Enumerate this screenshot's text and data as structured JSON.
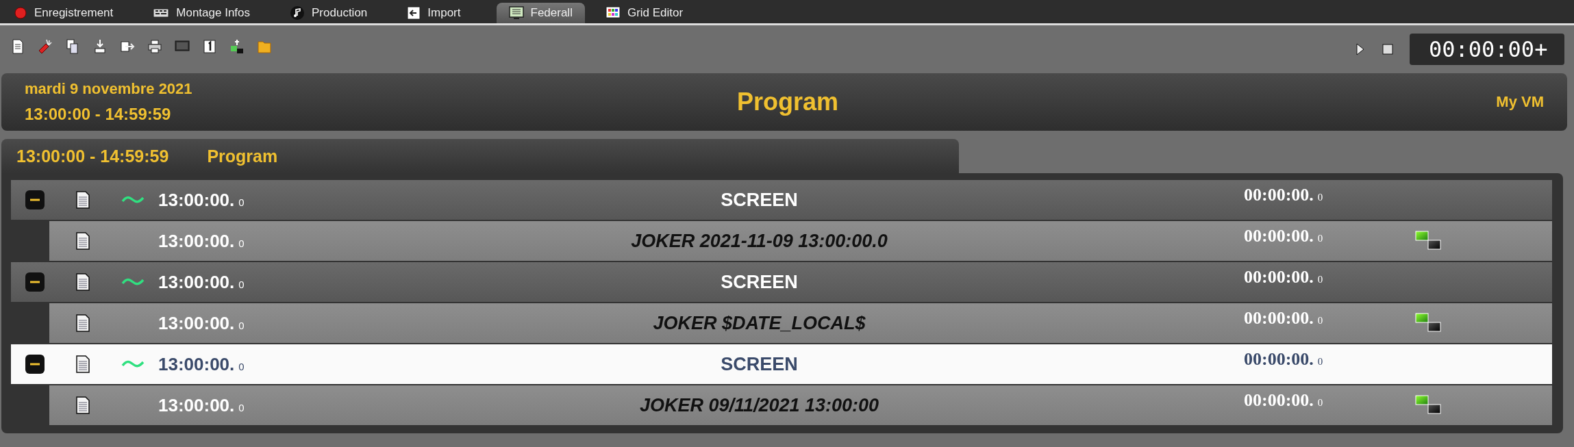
{
  "tabs": [
    {
      "label": "Enregistrement",
      "selected": false
    },
    {
      "label": "Montage Infos",
      "selected": false
    },
    {
      "label": "Production",
      "selected": false
    },
    {
      "label": "Import",
      "selected": false
    },
    {
      "label": "Federall",
      "selected": true
    },
    {
      "label": "Grid Editor",
      "selected": false
    }
  ],
  "timer": "00:00:00+",
  "header": {
    "date": "mardi 9 novembre 2021",
    "time_range": "13:00:00  -  14:59:59",
    "title": "Program",
    "station": "My VM"
  },
  "section": {
    "time_range": "13:00:00 - 14:59:59",
    "title": "Program"
  },
  "rows": [
    {
      "kind": "group",
      "expanded": true,
      "selected": false,
      "time": "13:00:00.",
      "time_fraction": "0",
      "title": "SCREEN",
      "duration": "00:00:00.",
      "duration_fraction": "0"
    },
    {
      "kind": "item",
      "selected": false,
      "time": "13:00:00.",
      "time_fraction": "0",
      "title": "JOKER 2021-11-09 13:00:00.0",
      "duration": "00:00:00.",
      "duration_fraction": "0"
    },
    {
      "kind": "group",
      "expanded": true,
      "selected": false,
      "time": "13:00:00.",
      "time_fraction": "0",
      "title": "SCREEN",
      "duration": "00:00:00.",
      "duration_fraction": "0"
    },
    {
      "kind": "item",
      "selected": false,
      "time": "13:00:00.",
      "time_fraction": "0",
      "title": "JOKER $DATE_LOCAL$",
      "duration": "00:00:00.",
      "duration_fraction": "0"
    },
    {
      "kind": "group",
      "expanded": true,
      "selected": true,
      "time": "13:00:00.",
      "time_fraction": "0",
      "title": "SCREEN",
      "duration": "00:00:00.",
      "duration_fraction": "0"
    },
    {
      "kind": "item",
      "selected": false,
      "time": "13:00:00.",
      "time_fraction": "0",
      "title": "JOKER 09/11/2021 13:00:00",
      "duration": "00:00:00.",
      "duration_fraction": "0"
    }
  ]
}
